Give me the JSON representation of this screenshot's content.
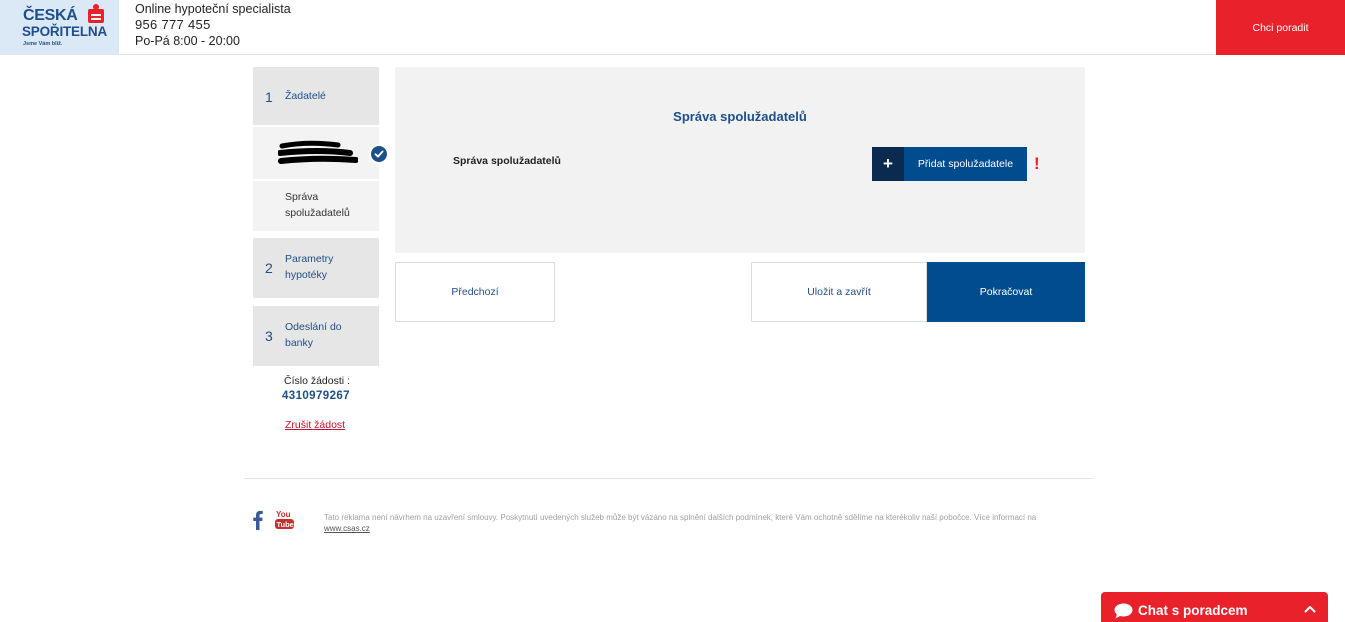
{
  "header": {
    "logo_line1": "ČESKÁ",
    "logo_line2": "SPOŘITELNA",
    "logo_tagline": "Jsme Vám blíž.",
    "contact_title": "Online hypoteční specialista",
    "contact_phone": "956 777 455",
    "contact_hours": "Po-Pá 8:00 - 20:00",
    "advise_button": "Chci poradit"
  },
  "sidebar": {
    "steps": [
      {
        "number": "1",
        "label": "Žadatelé"
      },
      {
        "number": "2",
        "label": "Parametry hypotéky"
      },
      {
        "number": "3",
        "label": "Odeslání do banky"
      }
    ],
    "subitem_label": "Správa spolužadatelů",
    "request_label": "Číslo žádosti :",
    "request_number": "4310979267",
    "cancel_link": "Zrušit žádost"
  },
  "panel": {
    "title": "Správa spolužadatelů",
    "row_label": "Správa spolužadatelů",
    "add_button": "Přidat spolužadatele",
    "add_icon": "+",
    "warning": "!"
  },
  "nav": {
    "previous": "Předchozí",
    "save_close": "Uložit a zavřít",
    "continue": "Pokračovat"
  },
  "footer": {
    "disclaimer": "Tato reklama není návrhem na uzavření smlouvy. Poskytnutí uvedených služeb může být vázáno na splnění dalších podmínek, které Vám ochotně sdělíme na kterékoliv naší pobočce. Více informací na",
    "link": "www.csas.cz",
    "icons": [
      "facebook-icon",
      "youtube-icon"
    ]
  },
  "chat": {
    "label": "Chat s poradcem"
  },
  "colors": {
    "brand_blue": "#004c8e",
    "accent_red": "#e8212b",
    "panel_gray": "#f2f2f2"
  }
}
